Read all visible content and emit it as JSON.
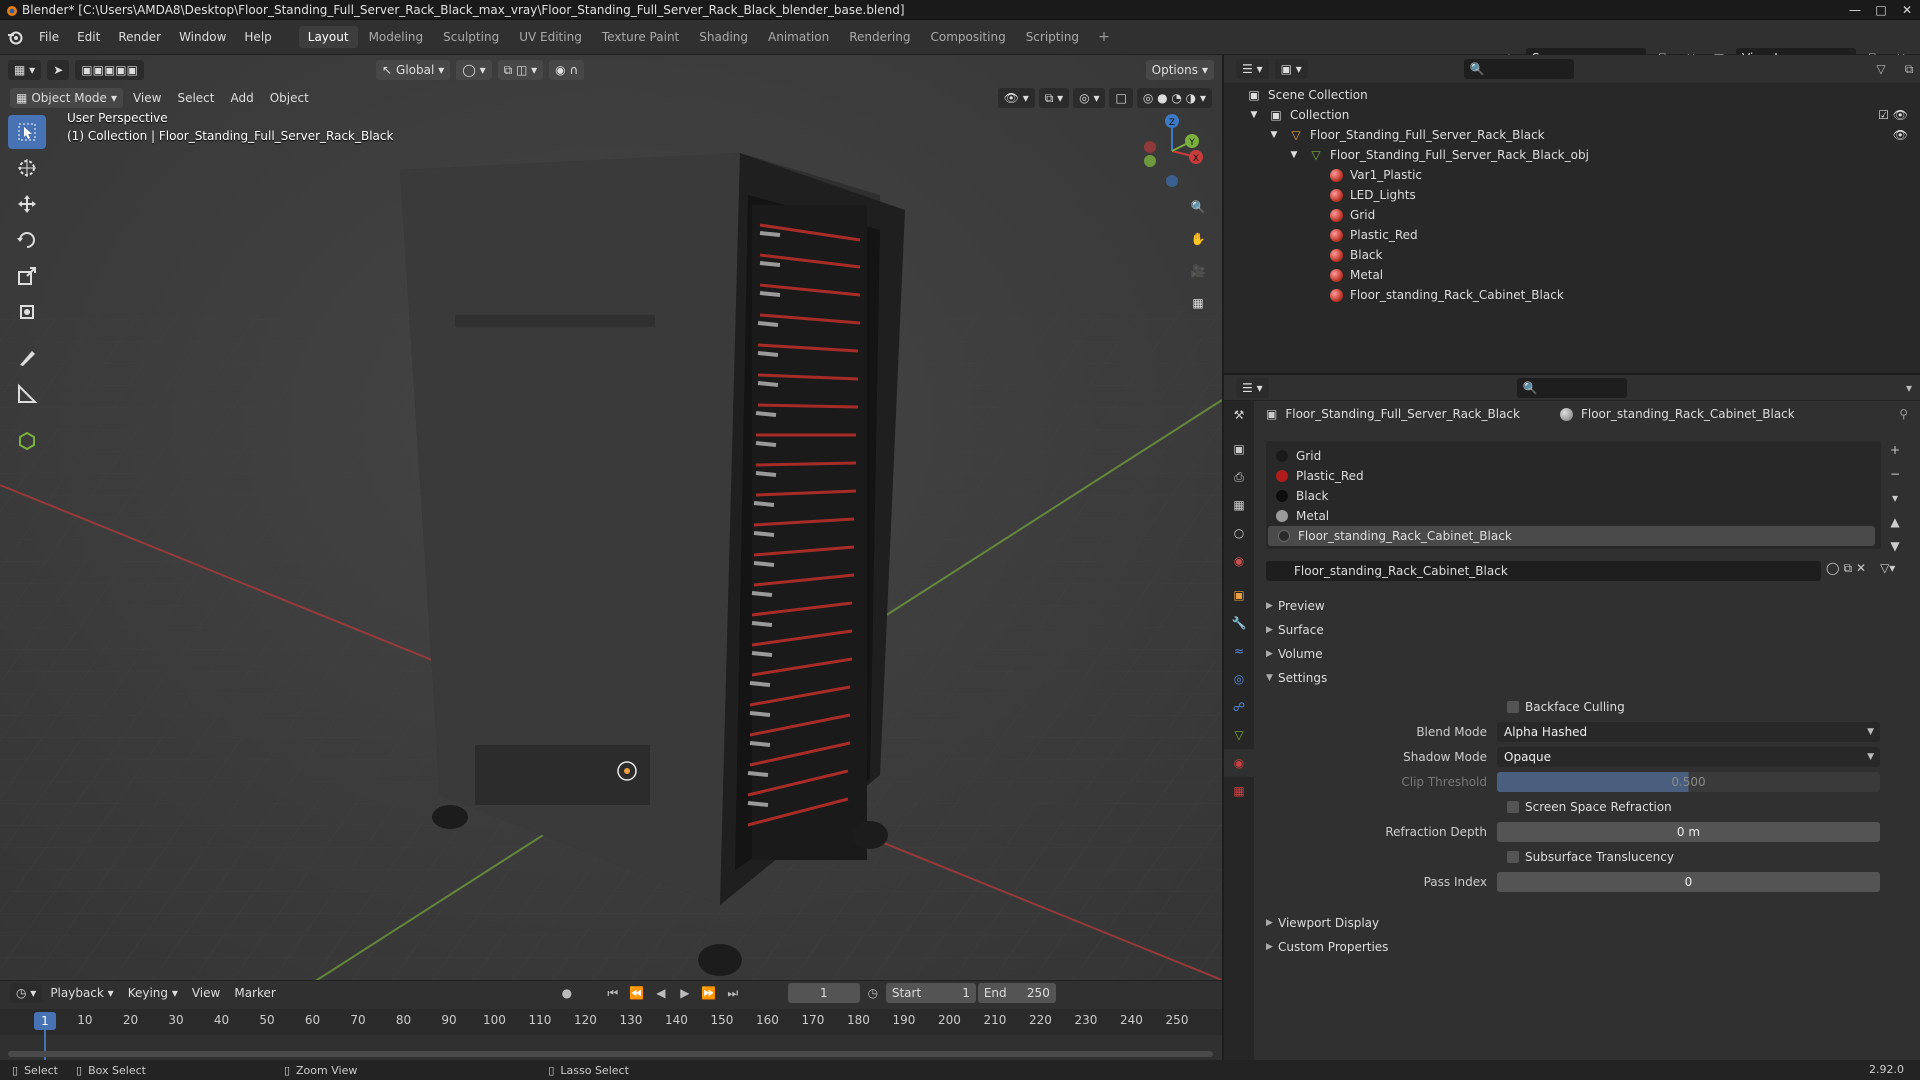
{
  "window": {
    "title": "Blender* [C:\\Users\\AMDA8\\Desktop\\Floor_Standing_Full_Server_Rack_Black_max_vray\\Floor_Standing_Full_Server_Rack_Black_blender_base.blend]"
  },
  "menu": [
    "File",
    "Edit",
    "Render",
    "Window",
    "Help"
  ],
  "workspaces": [
    "Layout",
    "Modeling",
    "Sculpting",
    "UV Editing",
    "Texture Paint",
    "Shading",
    "Animation",
    "Rendering",
    "Compositing",
    "Scripting"
  ],
  "active_workspace": "Layout",
  "scene": {
    "name": "Scene",
    "view_layer": "View Layer"
  },
  "viewport": {
    "transform": "Global",
    "options": "Options",
    "mode": "Object Mode",
    "menus": [
      "View",
      "Select",
      "Add",
      "Object"
    ],
    "info_line1": "User Perspective",
    "info_line2": "(1) Collection | Floor_Standing_Full_Server_Rack_Black",
    "axis_x": "X",
    "axis_y": "Y",
    "axis_z": "Z"
  },
  "outliner": {
    "root": "Scene Collection",
    "collection": "Collection",
    "object": "Floor_Standing_Full_Server_Rack_Black",
    "mesh": "Floor_Standing_Full_Server_Rack_Black_obj",
    "materials": [
      "Var1_Plastic",
      "LED_Lights",
      "Grid",
      "Plastic_Red",
      "Black",
      "Metal",
      "Floor_standing_Rack_Cabinet_Black"
    ]
  },
  "properties": {
    "crumb_object": "Floor_Standing_Full_Server_Rack_Black",
    "crumb_material": "Floor_standing_Rack_Cabinet_Black",
    "slots": [
      {
        "name": "Grid",
        "color": "#1a1a1a"
      },
      {
        "name": "Plastic_Red",
        "color": "#b01c1c"
      },
      {
        "name": "Black",
        "color": "#0d0d0d"
      },
      {
        "name": "Metal",
        "color": "#9a9a9a"
      },
      {
        "name": "Floor_standing_Rack_Cabinet_Black",
        "color": "#2a2a2a"
      }
    ],
    "material_name": "Floor_standing_Rack_Cabinet_Black",
    "panels": {
      "preview": "Preview",
      "surface": "Surface",
      "volume": "Volume",
      "settings": "Settings",
      "viewport_display": "Viewport Display",
      "custom_props": "Custom Properties"
    },
    "settings": {
      "backface_culling": "Backface Culling",
      "blend_mode_label": "Blend Mode",
      "blend_mode": "Alpha Hashed",
      "shadow_mode_label": "Shadow Mode",
      "shadow_mode": "Opaque",
      "clip_threshold_label": "Clip Threshold",
      "clip_threshold": "0.500",
      "ssr": "Screen Space Refraction",
      "refraction_depth_label": "Refraction Depth",
      "refraction_depth": "0 m",
      "subsurface": "Subsurface Translucency",
      "pass_index_label": "Pass Index",
      "pass_index": "0"
    }
  },
  "timeline": {
    "menus": [
      "Playback",
      "Keying",
      "View",
      "Marker"
    ],
    "current_frame": "1",
    "start_label": "Start",
    "start": "1",
    "end_label": "End",
    "end": "250",
    "ticks": [
      "1",
      "10",
      "20",
      "30",
      "40",
      "50",
      "60",
      "70",
      "80",
      "90",
      "100",
      "110",
      "120",
      "130",
      "140",
      "150",
      "160",
      "170",
      "180",
      "190",
      "200",
      "210",
      "220",
      "230",
      "240",
      "250"
    ]
  },
  "status": {
    "select": "Select",
    "box_select": "Box Select",
    "zoom_view": "Zoom View",
    "lasso_select": "Lasso Select",
    "version": "2.92.0"
  },
  "colors": {
    "accent": "#4772b3",
    "x_axis": "#c83c3c",
    "y_axis": "#7ab03c",
    "z_axis": "#3c7ac8"
  }
}
